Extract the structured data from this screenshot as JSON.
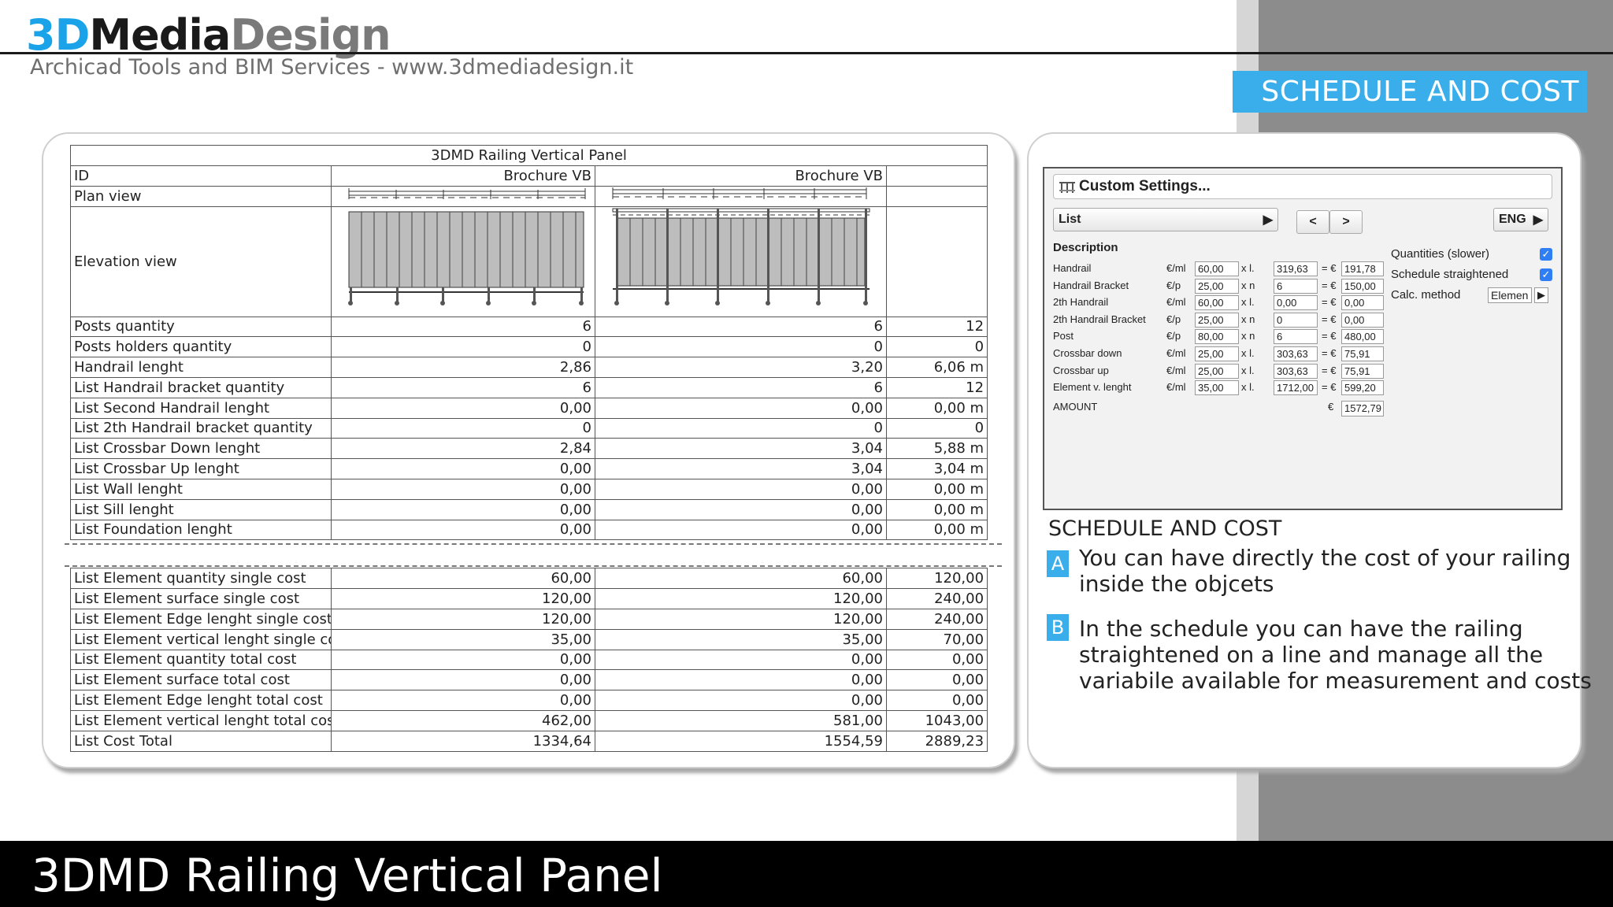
{
  "brand": {
    "logo_part1": "3D",
    "logo_part2": "Media",
    "logo_part3": "Design",
    "tagline": "Archicad Tools and BIM Services - www.3dmediadesign.it",
    "accent_color": "#3aaeea"
  },
  "section_badge": "SCHEDULE AND COST",
  "schedule": {
    "title": "3DMD Railing Vertical Panel",
    "id_label": "ID",
    "id_values": [
      "Brochure VB",
      "Brochure VB",
      ""
    ],
    "plan_label": "Plan view",
    "elevation_label": "Elevation view",
    "rows_top": [
      {
        "label": "Posts quantity",
        "v": [
          "6",
          "6",
          "12"
        ]
      },
      {
        "label": "Posts holders quantity",
        "v": [
          "0",
          "0",
          "0"
        ]
      },
      {
        "label": "Handrail lenght",
        "v": [
          "2,86",
          "3,20",
          "6,06 m"
        ]
      },
      {
        "label": "List Handrail bracket quantity",
        "v": [
          "6",
          "6",
          "12"
        ]
      },
      {
        "label": "List Second Handrail lenght",
        "v": [
          "0,00",
          "0,00",
          "0,00 m"
        ]
      },
      {
        "label": "List 2th Handrail bracket quantity",
        "v": [
          "0",
          "0",
          "0"
        ]
      },
      {
        "label": "List Crossbar Down lenght",
        "v": [
          "2,84",
          "3,04",
          "5,88 m"
        ]
      },
      {
        "label": "List Crossbar Up lenght",
        "v": [
          "0,00",
          "3,04",
          "3,04 m"
        ]
      },
      {
        "label": "List Wall lenght",
        "v": [
          "0,00",
          "0,00",
          "0,00 m"
        ]
      },
      {
        "label": "List Sill lenght",
        "v": [
          "0,00",
          "0,00",
          "0,00 m"
        ]
      },
      {
        "label": "List Foundation lenght",
        "v": [
          "0,00",
          "0,00",
          "0,00 m"
        ]
      }
    ],
    "rows_bottom": [
      {
        "label": "List Element quantity single cost",
        "v": [
          "60,00",
          "60,00",
          "120,00"
        ]
      },
      {
        "label": "List Element surface single cost",
        "v": [
          "120,00",
          "120,00",
          "240,00"
        ]
      },
      {
        "label": "List Element Edge lenght single cost",
        "v": [
          "120,00",
          "120,00",
          "240,00"
        ]
      },
      {
        "label": "List Element vertical lenght single cost",
        "v": [
          "35,00",
          "35,00",
          "70,00"
        ]
      },
      {
        "label": "List Element quantity total cost",
        "v": [
          "0,00",
          "0,00",
          "0,00"
        ]
      },
      {
        "label": "List Element surface total cost",
        "v": [
          "0,00",
          "0,00",
          "0,00"
        ]
      },
      {
        "label": "List Element Edge lenght total cost",
        "v": [
          "0,00",
          "0,00",
          "0,00"
        ]
      },
      {
        "label": "List Element vertical lenght total cost",
        "v": [
          "462,00",
          "581,00",
          "1043,00"
        ]
      },
      {
        "label": "List Cost Total",
        "v": [
          "1334,64",
          "1554,59",
          "2889,23"
        ]
      }
    ]
  },
  "settings": {
    "title": "Custom Settings...",
    "list_label": "List",
    "prev": "<",
    "next": ">",
    "lang": "ENG",
    "description_label": "Description",
    "rows": [
      {
        "name": "Handrail",
        "unit": "€/ml",
        "price": "60,00",
        "op": "x l.",
        "qty": "319,63",
        "eq": "= €",
        "total": "191,78"
      },
      {
        "name": "Handrail Bracket",
        "unit": "€/p",
        "price": "25,00",
        "op": "x n",
        "qty": "6",
        "eq": "= €",
        "total": "150,00"
      },
      {
        "name": "2th Handrail",
        "unit": "€/ml",
        "price": "60,00",
        "op": "x l.",
        "qty": "0,00",
        "eq": "= €",
        "total": "0,00"
      },
      {
        "name": "2th Handrail Bracket",
        "unit": "€/p",
        "price": "25,00",
        "op": "x n",
        "qty": "0",
        "eq": "= €",
        "total": "0,00"
      },
      {
        "name": "Post",
        "unit": "€/p",
        "price": "80,00",
        "op": "x n",
        "qty": "6",
        "eq": "= €",
        "total": "480,00"
      },
      {
        "name": "Crossbar down",
        "unit": "€/ml",
        "price": "25,00",
        "op": "x l.",
        "qty": "303,63",
        "eq": "= €",
        "total": "75,91"
      },
      {
        "name": "Crossbar up",
        "unit": "€/ml",
        "price": "25,00",
        "op": "x l.",
        "qty": "303,63",
        "eq": "= €",
        "total": "75,91"
      },
      {
        "name": "Element v. lenght",
        "unit": "€/ml",
        "price": "35,00",
        "op": "x l.",
        "qty": "1712,00",
        "eq": "= €",
        "total": "599,20"
      }
    ],
    "amount_label": "AMOUNT",
    "amount_currency": "€",
    "amount_value": "1572,79",
    "quantities_label": "Quantities (slower)",
    "schedule_straightened_label": "Schedule straightened",
    "calc_method_label": "Calc. method",
    "calc_method_value": "Elemen",
    "check_color": "#2f7ef4"
  },
  "info": {
    "heading": "SCHEDULE AND COST",
    "a_letter": "A",
    "a_line1": "You can have directly the cost of your railing",
    "a_line2": "inside the objcets",
    "b_letter": "B",
    "b_line1": "In the schedule you can have the railing",
    "b_line2": "straightened on a line  and manage all the",
    "b_line3": "variabile available for measurement and costs"
  },
  "footer_title": "3DMD Railing Vertical Panel"
}
